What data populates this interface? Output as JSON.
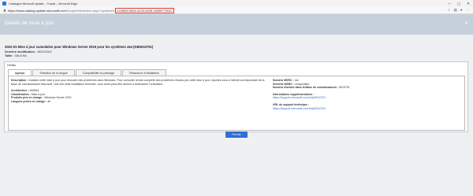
{
  "window": {
    "title": "Catalogue Microsoft Update – Travail – Microsoft Edge",
    "minimize_glyph": "—",
    "maximize_glyph": "▢",
    "close_glyph": "✕"
  },
  "address_bar": {
    "url_host": "https://www.catalog.update.microsoft.com",
    "url_path": "/ScopedViewInline.aspx?updateid=",
    "url_highlight": "e1f86f0f-9bbe-4043-8298-c60f6f775087"
  },
  "header": {
    "page_title": "Détails de mise à jour",
    "close_glyph": "✕"
  },
  "summary": {
    "update_title": "2022-01 Mise à jour cumulative pour Windows Server 2019 pour les systèmes x64 (KB5010791)",
    "last_modified_label": "Dernière modification :",
    "last_modified_value": "18/01/2022",
    "size_label": "Taille :",
    "size_value": "336,8 Mo"
  },
  "details": {
    "panel_label": "Détails",
    "tabs": [
      {
        "label": "Aperçu",
        "active": true
      },
      {
        "label": "Sélection de la langue",
        "active": false
      },
      {
        "label": "Compatibilité du package",
        "active": false
      },
      {
        "label": "Ressource d'installation",
        "active": false
      }
    ],
    "description_label": "Description :",
    "description_text": "Installez cette mise à jour pour résoudre des problèmes dans Windows. Pour consulter la liste complète des problèmes résolus par cette mise à jour, reportez-vous à l'article correspondant de la Base de connaissances Microsoft. Une fois cette installation terminée, vous serez peut-être amené à redémarrer l'ordinateur.",
    "architecture_label": "Architecture :",
    "architecture_value": "AMD64",
    "classification_label": "Classification :",
    "classification_value": "Mise à jour",
    "products_label": "Produits pris en charge :",
    "products_value": "Windows Server 2019",
    "languages_label": "Langues prises en charge :",
    "languages_value": "all",
    "msrc_number_label": "Numéro MSRC :",
    "msrc_number_value": "n/a",
    "msrc_severity_label": "Sévérité MSRC :",
    "msrc_severity_value": "Unspecified",
    "kb_label": "Numéro d'article dans la Base de connaissances :",
    "kb_value": "5010791",
    "more_info_label": "Informations supplémentaires :",
    "more_info_link": "https://support.microsoft.com/help/5010791",
    "support_url_label": "URL du support technique :",
    "support_url_link": "https://support.microsoft.com/help/5010791"
  },
  "footer": {
    "close_button_label": "Fermer"
  },
  "colors": {
    "header_band": "#c6d0da",
    "button_blue": "#2f6fd6",
    "link_blue": "#2a6fc9",
    "highlight_red": "#e53935"
  }
}
